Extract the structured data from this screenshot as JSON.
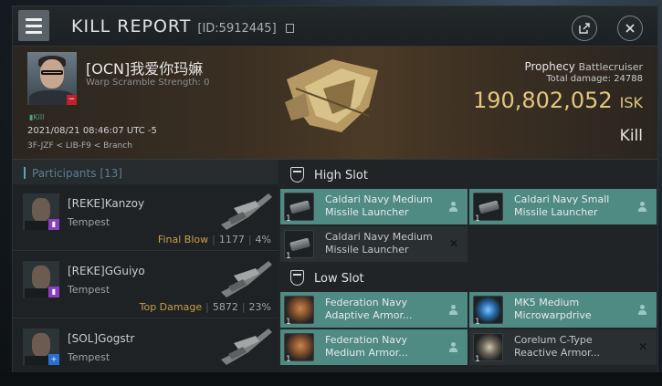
{
  "window": {
    "title": "KILL REPORT",
    "id_text": "[ID:5912445]"
  },
  "victim": {
    "name": "[OCN]我爱你玛嫲",
    "detail": "Warp Scramble Strength: 0",
    "status_tag": "Kill",
    "datetime": "2021/08/21 08:46:07 UTC -5",
    "location": "3F-JZF < LIB-F9 < Branch"
  },
  "ship": {
    "name": "Prophecy",
    "class": "Battlecruiser",
    "total_damage_label": "Total damage:",
    "total_damage": "24788",
    "isk_value": "190,802,052",
    "isk_unit": "ISK",
    "result": "Kill"
  },
  "participants": {
    "label": "Participants",
    "count": "[13]",
    "items": [
      {
        "name": "[REKE]Kanzoy",
        "ship": "Tempest",
        "tag": "Final Blow",
        "damage": "1177",
        "percent": "4%",
        "corp_color": "#8a3fc1"
      },
      {
        "name": "[REKE]GGuiyo",
        "ship": "Tempest",
        "tag": "Top Damage",
        "damage": "5872",
        "percent": "23%",
        "corp_color": "#8a3fc1"
      },
      {
        "name": "[SOL]Gogstr",
        "ship": "Tempest",
        "tag": "",
        "damage": "",
        "percent": "",
        "corp_color": "#2c6fd1"
      }
    ]
  },
  "fitting": {
    "high_slot": {
      "label": "High Slot",
      "modules": [
        {
          "name": "Caldari Navy Medium Missile Launcher",
          "qty": "1",
          "icon": "missile-launcher-icon",
          "state": "dropped"
        },
        {
          "name": "Caldari Navy Small Missile Launcher",
          "qty": "1",
          "icon": "missile-launcher-icon",
          "state": "dropped"
        },
        {
          "name": "Caldari Navy Medium Missile Launcher",
          "qty": "1",
          "icon": "missile-launcher-icon",
          "state": "destroyed"
        }
      ]
    },
    "low_slot": {
      "label": "Low Slot",
      "modules": [
        {
          "name": "Federation Navy Adaptive Armor...",
          "qty": "1",
          "icon": "armor-hardener-icon",
          "state": "dropped"
        },
        {
          "name": "MK5 Medium Microwarpdrive",
          "qty": "1",
          "icon": "microwarpdrive-icon",
          "state": "dropped"
        },
        {
          "name": "Federation Navy Medium Armor...",
          "qty": "1",
          "icon": "armor-repairer-icon",
          "state": "dropped"
        },
        {
          "name": "Corelum C-Type Reactive Armor...",
          "qty": "1",
          "icon": "reactive-armor-icon",
          "state": "destroyed"
        }
      ]
    }
  },
  "colors": {
    "dropped_bg": "#4f8a83",
    "destroyed_bg": "#2a2f32",
    "isk": "#e2c77f",
    "final_blow": "#c8a048"
  }
}
